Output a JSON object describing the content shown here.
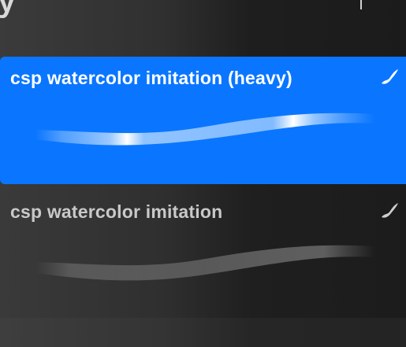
{
  "header": {
    "title_fragment": "y"
  },
  "brushes": [
    {
      "name": "csp watercolor imitation (heavy)",
      "selected": true,
      "icon": "brush-stroke-icon"
    },
    {
      "name": "csp watercolor imitation",
      "selected": false,
      "icon": "brush-stroke-icon"
    }
  ],
  "colors": {
    "selection_accent": "#0a76ff",
    "background_dark": "#1c1c1c",
    "text_selected": "#ffffff",
    "text_unselected": "#c9c9c9"
  }
}
